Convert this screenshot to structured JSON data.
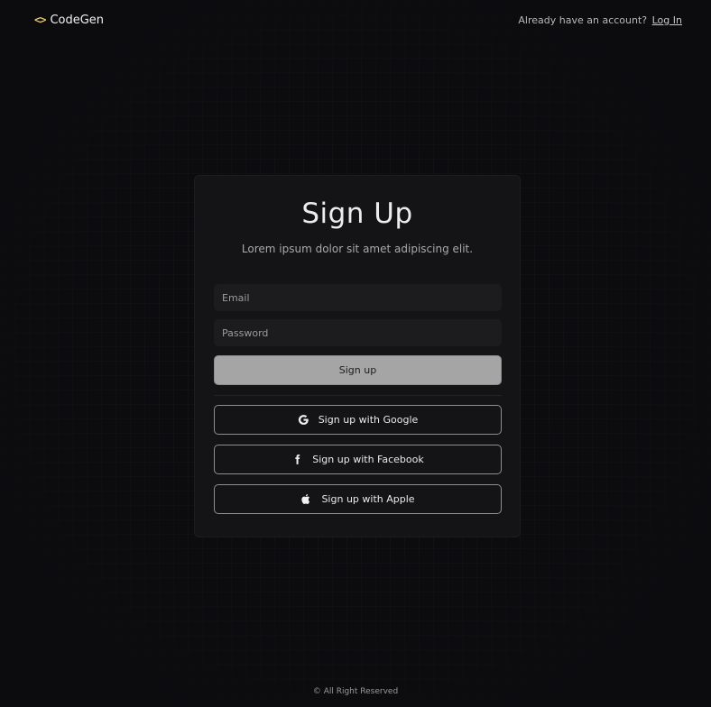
{
  "header": {
    "brand_icon": "<>",
    "brand_name": "CodeGen",
    "account_prompt": "Already have an account?",
    "login_link": "Log In"
  },
  "form": {
    "title": "Sign Up",
    "subtitle": "Lorem ipsum dolor sit amet adipiscing elit.",
    "email_placeholder": "Email",
    "password_placeholder": "Password",
    "submit_label": "Sign up",
    "social": [
      {
        "icon": "google-icon",
        "label": "Sign up with Google"
      },
      {
        "icon": "facebook-icon",
        "label": "Sign up with Facebook"
      },
      {
        "icon": "apple-icon",
        "label": "Sign up with Apple"
      }
    ]
  },
  "footer": {
    "text": "© All Right Reserved"
  },
  "colors": {
    "background": "#0c0c0f",
    "card": "#141416",
    "brand_accent": "#e2c766",
    "submit_bg": "#a5a5a5"
  }
}
